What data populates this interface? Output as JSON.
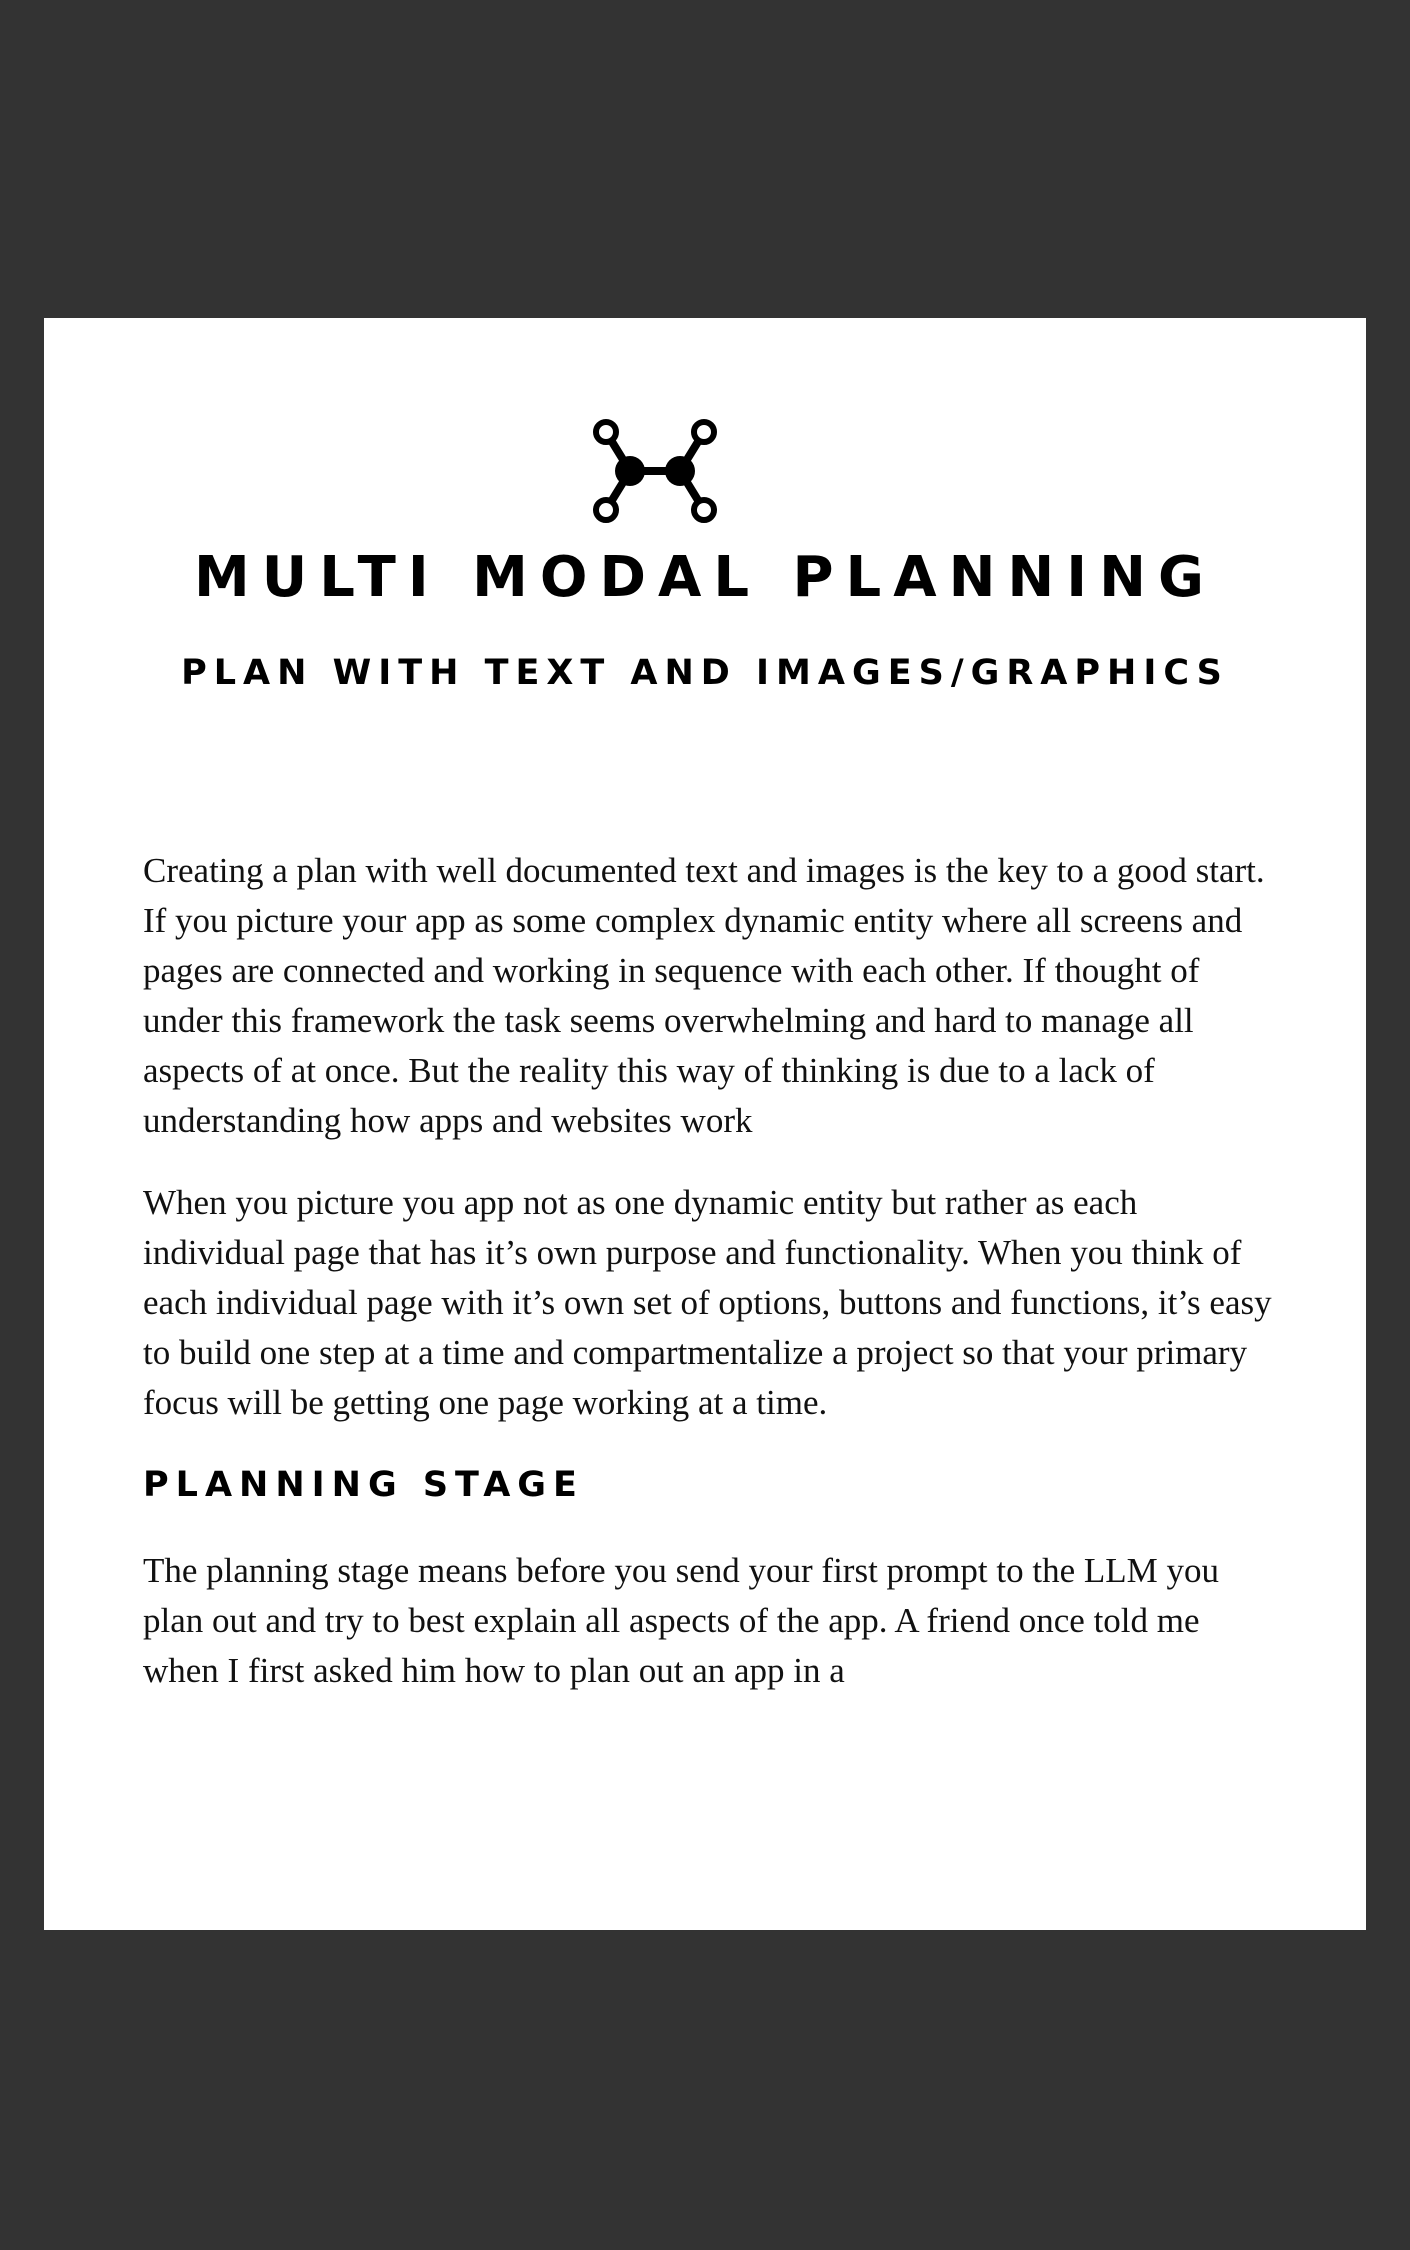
{
  "document": {
    "logo_icon": "node-graph-icon",
    "title": "MULTI MODAL PLANNING",
    "subtitle": "PLAN WITH TEXT AND IMAGES/GRAPHICS",
    "paragraphs": [
      "Creating a plan with well documented text and images is the key to a good start.  If you picture your app as some complex dynamic entity where all screens and pages are connected and working in sequence with each other.  If thought of under this framework the task seems overwhelming and hard to manage all aspects of at once.  But the reality this way of thinking is due to a lack of understanding how apps and websites work",
      "When you picture you app not as one dynamic entity but rather as each individual page that has it’s own purpose and functionality.  When you think of each individual page with it’s own set of options, buttons and functions, it’s easy to build one step at a time and compartmentalize a project so that your primary focus will be getting one page working at a time."
    ],
    "section_heading": "PLANNING STAGE",
    "section_paragraph": "The planning stage means before you send your first prompt to the LLM you plan out and try to best explain all aspects of the app.  A friend once told me when I first asked him how to plan out an app in a"
  },
  "colors": {
    "background": "#333333",
    "page": "#ffffff",
    "text": "#111111"
  }
}
